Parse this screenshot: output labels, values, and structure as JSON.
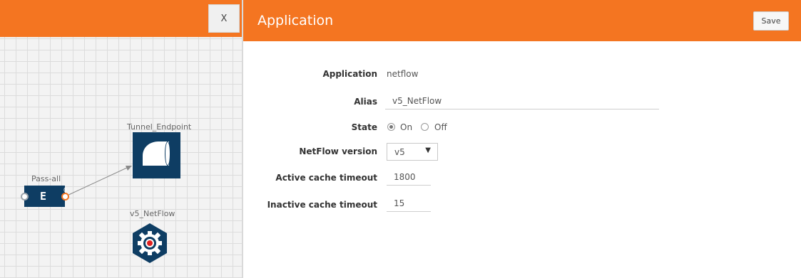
{
  "canvas": {
    "close_label": "X",
    "nodes": {
      "tunnel_label": "Tunnel_Endpoint",
      "pass_label": "Pass-all",
      "pass_glyph": "E",
      "pass_port_number": "0",
      "netflow_label": "v5_NetFlow"
    }
  },
  "panel": {
    "title": "Application",
    "save_label": "Save",
    "application": {
      "label": "Application",
      "value": "netflow"
    },
    "alias": {
      "label": "Alias",
      "value": "v5_NetFlow"
    },
    "state": {
      "label": "State",
      "on_label": "On",
      "off_label": "Off",
      "selected": "On"
    },
    "netflow_version": {
      "label": "NetFlow version",
      "value": "v5"
    },
    "active_cache_timeout": {
      "label": "Active cache timeout",
      "value": "1800"
    },
    "inactive_cache_timeout": {
      "label": "Inactive cache timeout",
      "value": "15"
    }
  },
  "colors": {
    "accent": "#f47521",
    "node": "#0e3d63"
  },
  "icons": [
    "close-icon",
    "tunnel-icon",
    "filter-icon",
    "gear-icon",
    "chevron-down-icon"
  ]
}
